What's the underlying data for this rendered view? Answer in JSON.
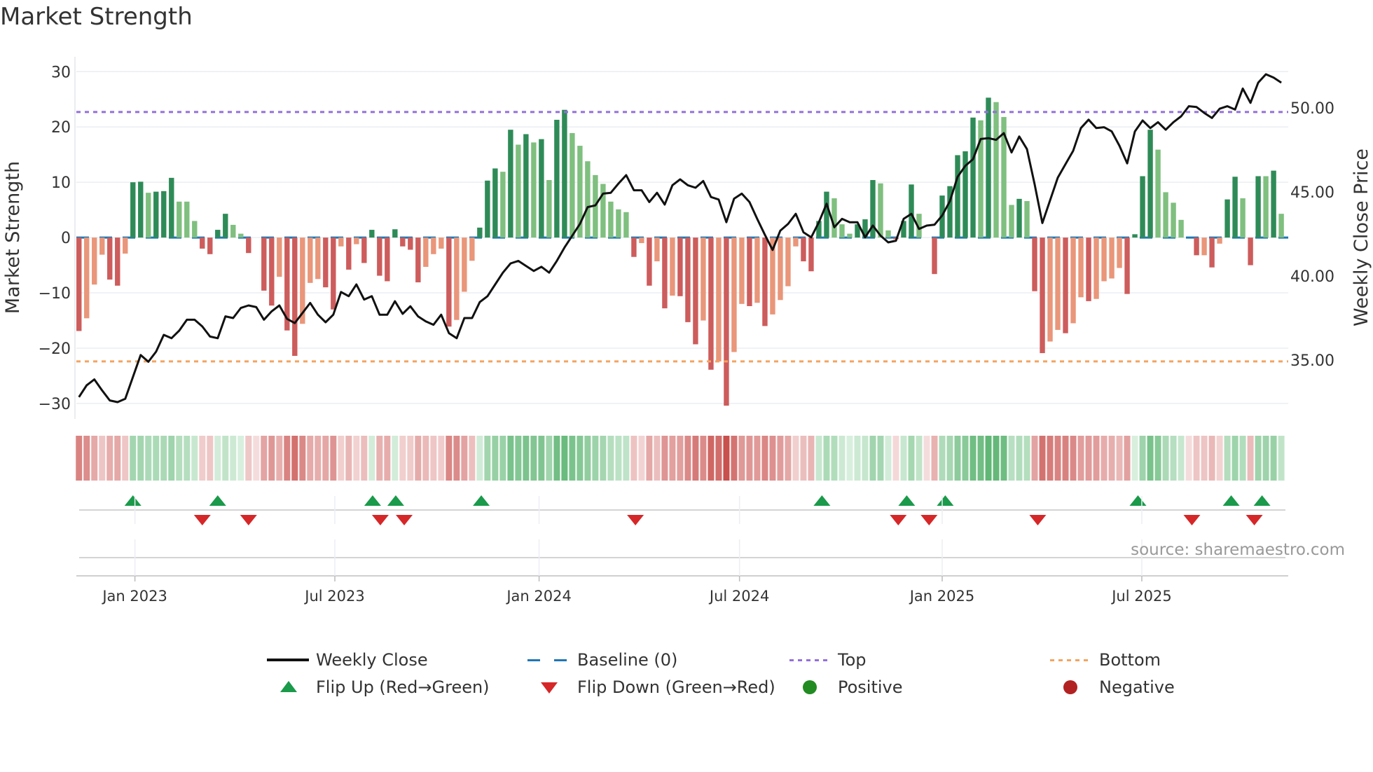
{
  "chart_data": {
    "type": "bar",
    "title": "Market Strength",
    "ylabel": "Market Strength",
    "y2label": "Weekly Close Price",
    "ylim": [
      -32.8,
      32.7
    ],
    "y2lim": [
      31.5,
      53.04
    ],
    "xlim": [
      -0.34,
      156.9
    ],
    "yticks": [
      30,
      20,
      10,
      0,
      -10,
      -20,
      -30
    ],
    "ytick_labels": [
      "30",
      "20",
      "10",
      "0",
      "−10",
      "−20",
      "−30"
    ],
    "y2ticks": [
      50,
      45,
      40,
      35
    ],
    "y2tick_labels": [
      "50.00",
      "45.00",
      "40.00",
      "35.00"
    ],
    "xticks": [
      {
        "label": "Jan 2023",
        "week": 7.26
      },
      {
        "label": "Jul 2023",
        "week": 33.2
      },
      {
        "label": "Jan 2024",
        "week": 59.7
      },
      {
        "label": "Jul 2024",
        "week": 85.7
      },
      {
        "label": "Jan 2025",
        "week": 112.0
      },
      {
        "label": "Jul 2025",
        "week": 137.9
      }
    ],
    "top_level": 22.7,
    "bottom_level": -22.4,
    "grid": true,
    "strength": [
      -16.9,
      -14.6,
      -8.5,
      -3.1,
      -7.6,
      -8.7,
      -2.9,
      10.0,
      10.1,
      8.1,
      8.3,
      8.4,
      10.8,
      6.5,
      6.5,
      3.0,
      -2.0,
      -3.0,
      1.4,
      4.3,
      2.3,
      0.7,
      -2.8,
      0,
      -9.6,
      -12.3,
      -7.1,
      -16.8,
      -21.4,
      -15.6,
      -8.2,
      -7.5,
      -9.0,
      -13.0,
      -1.6,
      -5.8,
      -1.2,
      -4.6,
      1.4,
      -6.9,
      -7.9,
      1.5,
      -1.6,
      -2.2,
      -8.1,
      -5.3,
      -3.0,
      -2.0,
      -16.1,
      -14.9,
      -9.8,
      -4.2,
      1.8,
      10.3,
      12.5,
      11.9,
      19.5,
      16.8,
      18.7,
      17.2,
      17.8,
      10.4,
      21.3,
      23.1,
      18.9,
      16.6,
      13.8,
      11.3,
      9.7,
      6.5,
      5.1,
      4.6,
      -3.5,
      -1.0,
      -8.7,
      -4.3,
      -12.8,
      -10.5,
      -10.6,
      -15.3,
      -19.3,
      -15.0,
      -23.9,
      -22.4,
      -30.4,
      -20.7,
      -12.0,
      -12.4,
      -11.8,
      -16.0,
      -13.9,
      -11.3,
      -8.8,
      -1.6,
      -4.3,
      -6.1,
      3.0,
      8.3,
      7.1,
      2.4,
      0.7,
      2.4,
      3.3,
      10.4,
      9.8,
      1.3,
      -0.3,
      3.0,
      9.6,
      4.3,
      0,
      -6.6,
      7.6,
      9.3,
      14.9,
      15.6,
      21.7,
      21.2,
      25.3,
      24.5,
      21.8,
      5.9,
      7.0,
      6.6,
      -9.7,
      -20.9,
      -18.8,
      -16.7,
      -17.3,
      -15.5,
      -10.8,
      -11.5,
      -11.1,
      -7.9,
      -7.4,
      -5.5,
      -10.2,
      0.6,
      11.1,
      19.5,
      15.9,
      8.2,
      6.3,
      3.2,
      0,
      -3.2,
      -3.2,
      -5.4,
      -1.1,
      6.9,
      11.0,
      7.1,
      -5.0,
      11.1,
      11.1,
      12.1,
      4.3
    ],
    "weekly_close": [
      32.8,
      33.5,
      33.85,
      33.2,
      32.6,
      32.5,
      32.7,
      34.0,
      35.3,
      34.9,
      35.5,
      36.5,
      36.3,
      36.75,
      37.4,
      37.4,
      37.0,
      36.4,
      36.3,
      37.6,
      37.5,
      38.1,
      38.25,
      38.15,
      37.4,
      37.9,
      38.25,
      37.45,
      37.2,
      37.8,
      38.4,
      37.7,
      37.25,
      37.7,
      39.05,
      38.8,
      39.5,
      38.6,
      38.8,
      37.7,
      37.7,
      38.5,
      37.75,
      38.2,
      37.6,
      37.3,
      37.1,
      37.7,
      36.6,
      36.3,
      37.5,
      37.5,
      38.45,
      38.8,
      39.5,
      40.2,
      40.75,
      40.9,
      40.6,
      40.3,
      40.55,
      40.2,
      40.9,
      41.7,
      42.4,
      43.1,
      44.1,
      44.2,
      44.9,
      44.95,
      45.5,
      46.0,
      45.1,
      45.1,
      44.4,
      44.95,
      44.25,
      45.4,
      45.75,
      45.4,
      45.25,
      45.65,
      44.7,
      44.55,
      43.2,
      44.6,
      44.9,
      44.4,
      43.4,
      42.45,
      41.55,
      42.7,
      43.1,
      43.7,
      42.6,
      42.3,
      43.2,
      44.3,
      42.9,
      43.4,
      43.2,
      43.2,
      42.3,
      43.0,
      42.4,
      42.0,
      42.1,
      43.4,
      43.7,
      42.8,
      43.0,
      43.05,
      43.6,
      44.45,
      45.9,
      46.55,
      46.95,
      48.15,
      48.2,
      48.1,
      48.5,
      47.35,
      48.3,
      47.55,
      45.45,
      43.15,
      44.5,
      45.85,
      46.65,
      47.45,
      48.8,
      49.3,
      48.8,
      48.85,
      48.6,
      47.75,
      46.7,
      48.6,
      49.25,
      48.8,
      49.15,
      48.7,
      49.15,
      49.5,
      50.1,
      50.05,
      49.7,
      49.4,
      49.95,
      50.1,
      49.9,
      51.15,
      50.3,
      51.5,
      52.0,
      51.8,
      51.5
    ],
    "flip_up_weeks": [
      7.0,
      18.0,
      38.1,
      41.1,
      52.2,
      96.4,
      107.4,
      112.4,
      137.4,
      149.5,
      153.5
    ],
    "flip_down_weeks": [
      16.0,
      22.0,
      39.1,
      42.2,
      72.2,
      106.3,
      110.3,
      124.4,
      144.4,
      152.5
    ],
    "legend": {
      "placement": "bottom",
      "entries": [
        {
          "label": "Weekly Close",
          "key": "line"
        },
        {
          "label": "Baseline (0)",
          "key": "dash"
        },
        {
          "label": "Top",
          "key": "dot-purple"
        },
        {
          "label": "Bottom",
          "key": "dot-orange"
        },
        {
          "label": "Flip Up (Red→Green)",
          "key": "triangle-up"
        },
        {
          "label": "Flip Down (Green→Red)",
          "key": "triangle-down"
        },
        {
          "label": "Positive",
          "key": "circle-green"
        },
        {
          "label": "Negative",
          "key": "circle-red"
        }
      ]
    },
    "annotation": "source: sharemaestro.com",
    "colors": {
      "pos_rising": "#2e8b57",
      "pos_falling": "#7fbf7f",
      "neg_rising": "#cd5c5c",
      "neg_falling": "#e9967a",
      "baseline": "#1f77b4",
      "top": "#9370db",
      "bottom": "#f4a460",
      "close": "#111111",
      "flip_up": "#1a9a4a",
      "flip_down": "#d62728",
      "positive": "#228b22",
      "negative": "#b22222",
      "grid": "#ebedf2"
    }
  }
}
